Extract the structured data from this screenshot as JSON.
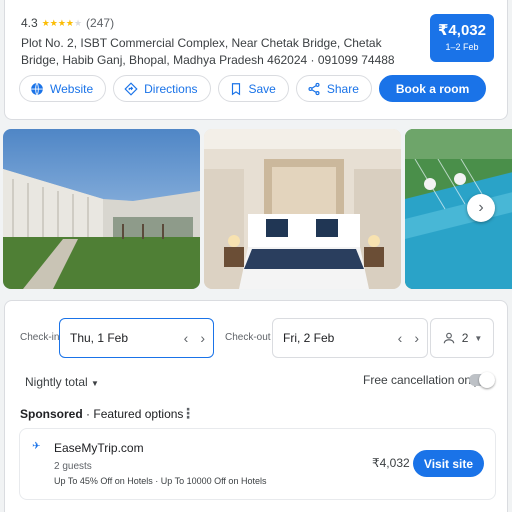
{
  "hotel": {
    "rating": "4.3",
    "review_count": "(247)",
    "address": "Plot No. 2, ISBT Commercial Complex, Near Chetak Bridge, Chetak Bridge, Habib Ganj, Bhopal, Madhya Pradesh 462024 · 091099 74488"
  },
  "price_box": {
    "price": "₹4,032",
    "dates": "1–2 Feb"
  },
  "actions": {
    "website": "Website",
    "directions": "Directions",
    "save": "Save",
    "share": "Share",
    "book": "Book a room"
  },
  "booking": {
    "checkin_label": "Check-in",
    "checkin_value": "Thu, 1 Feb",
    "checkout_label": "Check-out",
    "checkout_value": "Fri, 2 Feb",
    "guests": "2",
    "nightly_total": "Nightly total",
    "free_cancellation": "Free cancellation only",
    "free_cancellation_on": false
  },
  "sponsored": {
    "label": "Sponsored",
    "heading": "Featured options",
    "offer": {
      "name": "EaseMyTrip.com",
      "guests": "2 guests",
      "promo": "Up To 45% Off on Hotels · Up To 10000 Off on Hotels",
      "price": "₹4,032",
      "button": "Visit site"
    }
  },
  "colors": {
    "accent": "#1a73e8",
    "star": "#fbbc04"
  },
  "icons": [
    "globe-icon",
    "directions-icon",
    "bookmark-icon",
    "share-icon",
    "chevron-left-icon",
    "chevron-right-icon",
    "person-icon",
    "caret-down-icon",
    "more-vert-icon",
    "plane-icon"
  ]
}
